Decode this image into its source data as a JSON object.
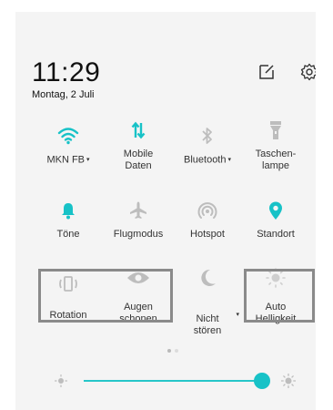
{
  "header": {
    "time": "11:29",
    "date": "Montag, 2 Juli"
  },
  "colors": {
    "accent": "#17c2c7",
    "icon_off": "#bdbdbd",
    "panel_bg": "#f4f4f4"
  },
  "row1": [
    {
      "label": "MKN FB",
      "icon": "wifi-icon",
      "state": "on",
      "dropdown": "▾"
    },
    {
      "label": "Mobile\nDaten",
      "icon": "mobile-data-icon",
      "state": "on"
    },
    {
      "label": "Bluetooth",
      "icon": "bluetooth-icon",
      "state": "off",
      "dropdown": "▾"
    },
    {
      "label": "Taschen-\nlampe",
      "icon": "flashlight-icon",
      "state": "off"
    }
  ],
  "row2": [
    {
      "label": "Töne",
      "icon": "bell-icon",
      "state": "on"
    },
    {
      "label": "Flugmodus",
      "icon": "airplane-icon",
      "state": "off"
    },
    {
      "label": "Hotspot",
      "icon": "hotspot-icon",
      "state": "off"
    },
    {
      "label": "Standort",
      "icon": "location-icon",
      "state": "on"
    }
  ],
  "row3": [
    {
      "label": "Rotation",
      "icon": "rotation-icon",
      "state": "off"
    },
    {
      "label": "Augen\nschonen",
      "icon": "eye-icon",
      "state": "off"
    },
    {
      "label": "Nicht\nstören",
      "icon": "moon-icon",
      "state": "off",
      "dropdown": "▾"
    },
    {
      "label": "Auto\nHelligkeit",
      "icon": "brightness-icon",
      "state": "off"
    }
  ],
  "pager": {
    "pages": 2,
    "current": 1
  },
  "brightness": {
    "level": 0.92
  }
}
